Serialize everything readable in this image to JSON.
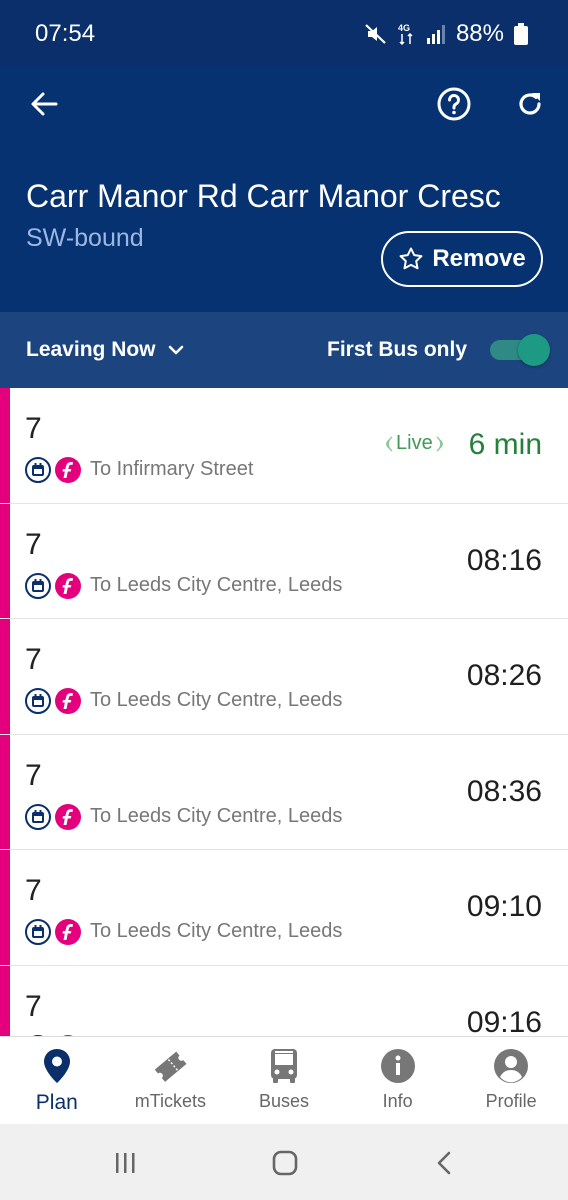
{
  "status_bar": {
    "time": "07:54",
    "network": "4G",
    "battery": "88%"
  },
  "header": {
    "stop_name": "Carr Manor Rd Carr Manor Cresc",
    "direction": "SW-bound",
    "remove_label": "Remove"
  },
  "filters": {
    "leaving_label": "Leaving Now",
    "first_bus_label": "First Bus only",
    "first_bus_only": true
  },
  "live_label": "Live",
  "departures": [
    {
      "route": "7",
      "destination": "To Infirmary Street",
      "time": "6 min",
      "live": true
    },
    {
      "route": "7",
      "destination": "To Leeds City Centre, Leeds",
      "time": "08:16",
      "live": false
    },
    {
      "route": "7",
      "destination": "To Leeds City Centre, Leeds",
      "time": "08:26",
      "live": false
    },
    {
      "route": "7",
      "destination": "To Leeds City Centre, Leeds",
      "time": "08:36",
      "live": false
    },
    {
      "route": "7",
      "destination": "To Leeds City Centre, Leeds",
      "time": "09:10",
      "live": false
    },
    {
      "route": "7",
      "destination": "",
      "time": "09:16",
      "live": false
    }
  ],
  "nav": {
    "items": [
      {
        "label": "Plan",
        "icon": "location-pin-icon",
        "active": true
      },
      {
        "label": "mTickets",
        "icon": "ticket-icon",
        "active": false
      },
      {
        "label": "Buses",
        "icon": "bus-icon",
        "active": false
      },
      {
        "label": "Info",
        "icon": "info-icon",
        "active": false
      },
      {
        "label": "Profile",
        "icon": "profile-icon",
        "active": false
      }
    ]
  },
  "colors": {
    "header_bg": "#073271",
    "filter_bg": "#1c4580",
    "route_accent": "#e4007c",
    "live_green": "#23813b",
    "toggle_on": "#1d9a83"
  }
}
